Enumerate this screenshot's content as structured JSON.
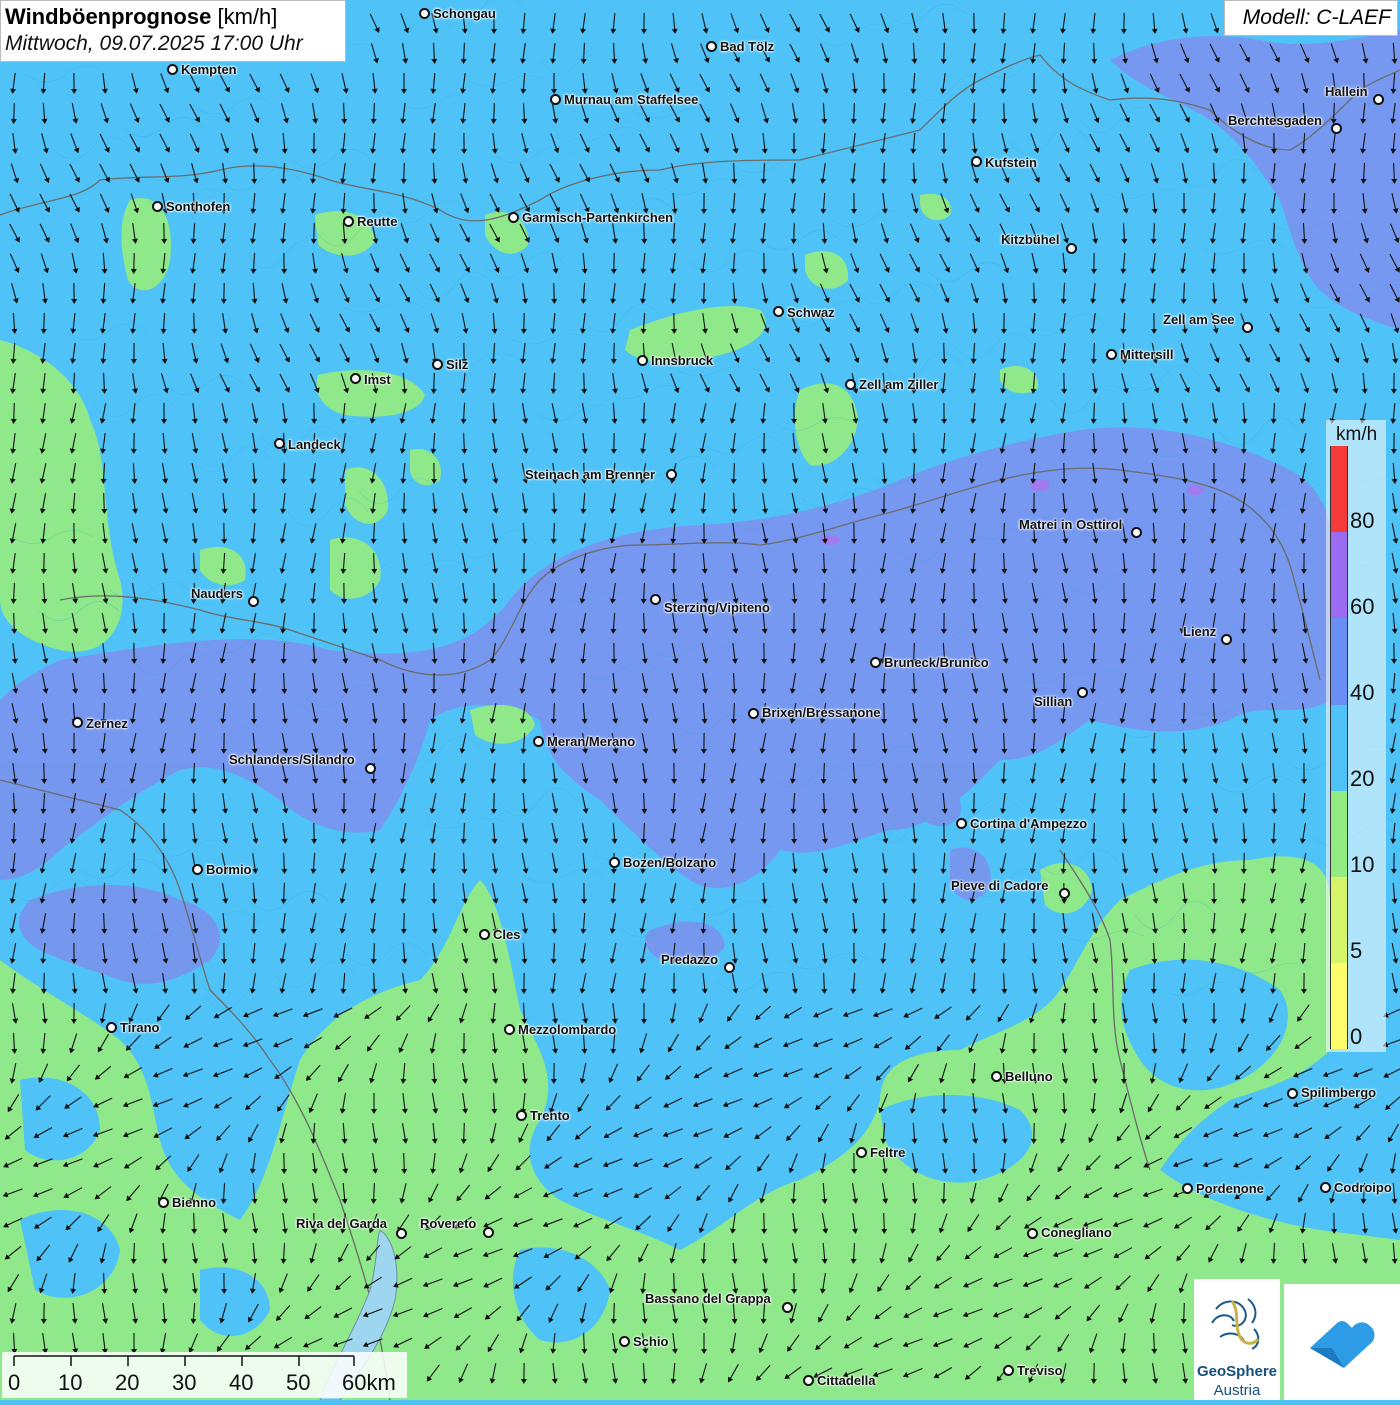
{
  "title": {
    "main_bold": "Windböenprognose",
    "main_unit": " [km/h]",
    "subtitle": "Mittwoch, 09.07.2025 17:00 Uhr"
  },
  "model": "Modell: C-LAEF",
  "legend": {
    "unit": "km/h",
    "ticks": [
      "80",
      "60",
      "40",
      "20",
      "10",
      "5",
      "0"
    ],
    "colors": {
      "c_0_5": "#fdfd6b",
      "c_5_10": "#d7f56b",
      "c_10_20": "#92ec82",
      "c_20_40": "#4fc3f7",
      "c_40_60": "#6b8ef5",
      "c_60_80": "#9b6bf2",
      "c_80_plus": "#f53a3a"
    }
  },
  "scale": {
    "labels": [
      "0",
      "10",
      "20",
      "30",
      "40",
      "50",
      "60km"
    ]
  },
  "cities": [
    {
      "name": "Schongau"
    },
    {
      "name": "Bad Tölz"
    },
    {
      "name": "Kempten"
    },
    {
      "name": "Murnau am Staffelsee"
    },
    {
      "name": "Hallein"
    },
    {
      "name": "Berchtesgaden"
    },
    {
      "name": "Kufstein"
    },
    {
      "name": "Sonthofen"
    },
    {
      "name": "Reutte"
    },
    {
      "name": "Garmisch-Partenkirchen"
    },
    {
      "name": "Kitzbühel"
    },
    {
      "name": "Schwaz"
    },
    {
      "name": "Zell am See"
    },
    {
      "name": "Mittersill"
    },
    {
      "name": "Innsbruck"
    },
    {
      "name": "Imst"
    },
    {
      "name": "Silz"
    },
    {
      "name": "Zell am Ziller"
    },
    {
      "name": "Landeck"
    },
    {
      "name": "Steinach am Brenner"
    },
    {
      "name": "Matrei in Osttirol"
    },
    {
      "name": "Nauders"
    },
    {
      "name": "Sterzing/Vipiteno"
    },
    {
      "name": "Lienz"
    },
    {
      "name": "Bruneck/Brunico"
    },
    {
      "name": "Sillian"
    },
    {
      "name": "Brixen/Bressanone"
    },
    {
      "name": "Zernez"
    },
    {
      "name": "Meran/Merano"
    },
    {
      "name": "Schlanders/Silandro"
    },
    {
      "name": "Cortina d'Ampezzo"
    },
    {
      "name": "Bozen/Bolzano"
    },
    {
      "name": "Bormio"
    },
    {
      "name": "Pieve di Cadore"
    },
    {
      "name": "Cles"
    },
    {
      "name": "Predazzo"
    },
    {
      "name": "Tirano"
    },
    {
      "name": "Mezzolombardo"
    },
    {
      "name": "Belluno"
    },
    {
      "name": "Spilimbergo"
    },
    {
      "name": "Trento"
    },
    {
      "name": "Feltre"
    },
    {
      "name": "Pordenone"
    },
    {
      "name": "Codroipo"
    },
    {
      "name": "Bienno"
    },
    {
      "name": "Riva del Garda"
    },
    {
      "name": "Rovereto"
    },
    {
      "name": "Conegliano"
    },
    {
      "name": "Bassano del Grappa"
    },
    {
      "name": "Schio"
    },
    {
      "name": "Treviso"
    },
    {
      "name": "Cittadella"
    }
  ],
  "logo": {
    "line1": "GeoSphere",
    "line2": "Austria"
  }
}
